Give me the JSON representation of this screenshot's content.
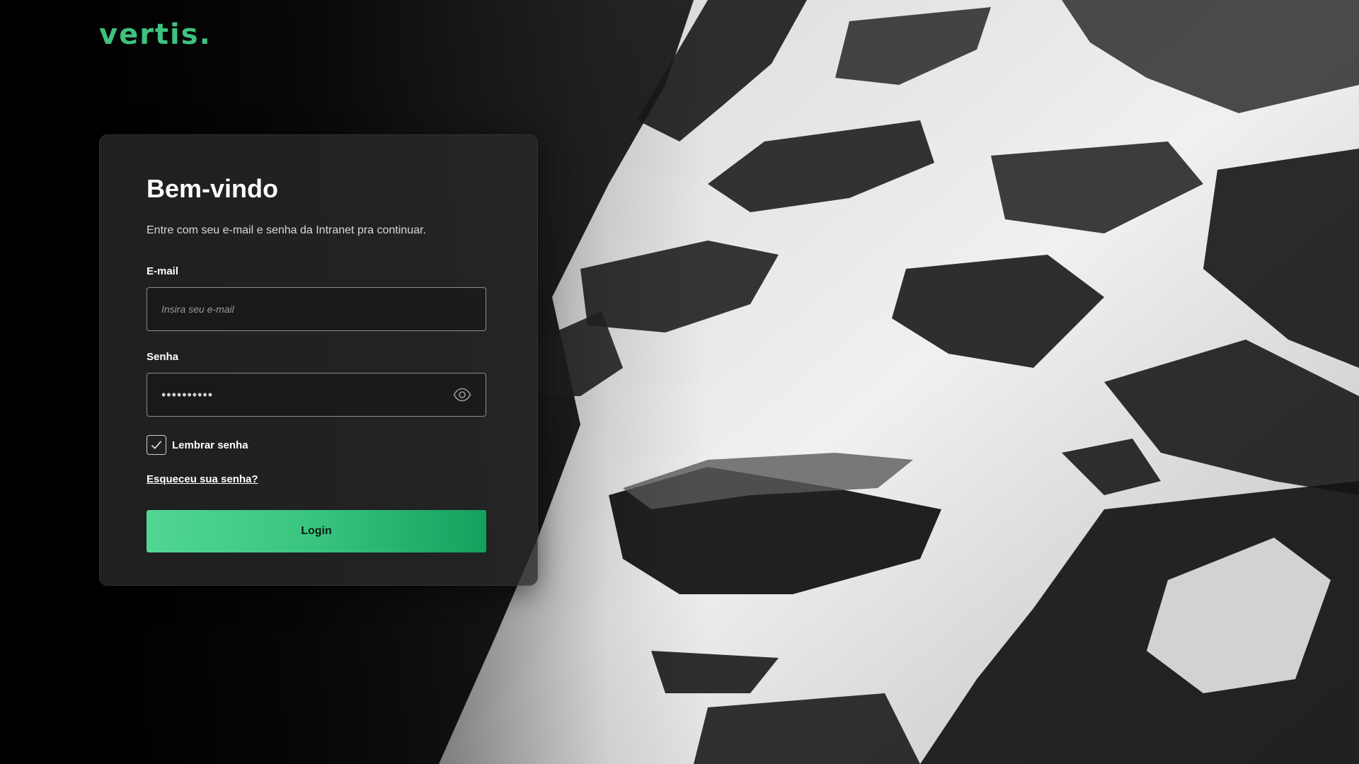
{
  "brand": {
    "logo_text": "vertis.",
    "accent_color": "#3fc27f"
  },
  "login": {
    "title": "Bem-vindo",
    "subtitle": "Entre com seu e-mail e senha da Intranet pra continuar.",
    "email_label": "E-mail",
    "email_placeholder": "Insira seu e-mail",
    "email_value": "",
    "password_label": "Senha",
    "password_value": "••••••••••",
    "password_toggle_icon": "eye-icon",
    "remember_label": "Lembrar senha",
    "remember_checked": true,
    "forgot_link": "Esqueceu sua senha?",
    "submit_label": "Login",
    "button_gradient": [
      "#52d695",
      "#15a05d"
    ]
  }
}
